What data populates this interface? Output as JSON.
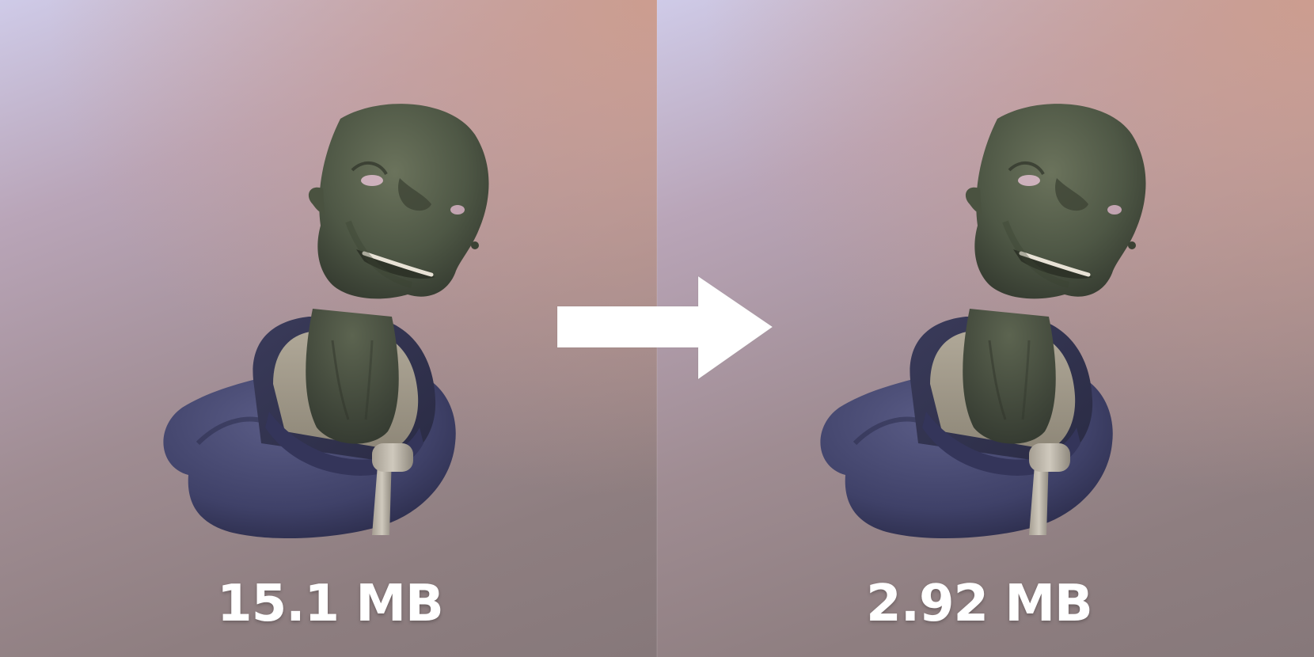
{
  "comparison": {
    "before": {
      "size_label": "15.1 MB"
    },
    "after": {
      "size_label": "2.92 MB"
    }
  },
  "icons": {
    "arrow": "arrow-right-icon"
  },
  "colors": {
    "label_text": "#ffffff",
    "arrow_fill": "#ffffff",
    "skin": "#4f5844",
    "hoodie": "#45476f"
  }
}
